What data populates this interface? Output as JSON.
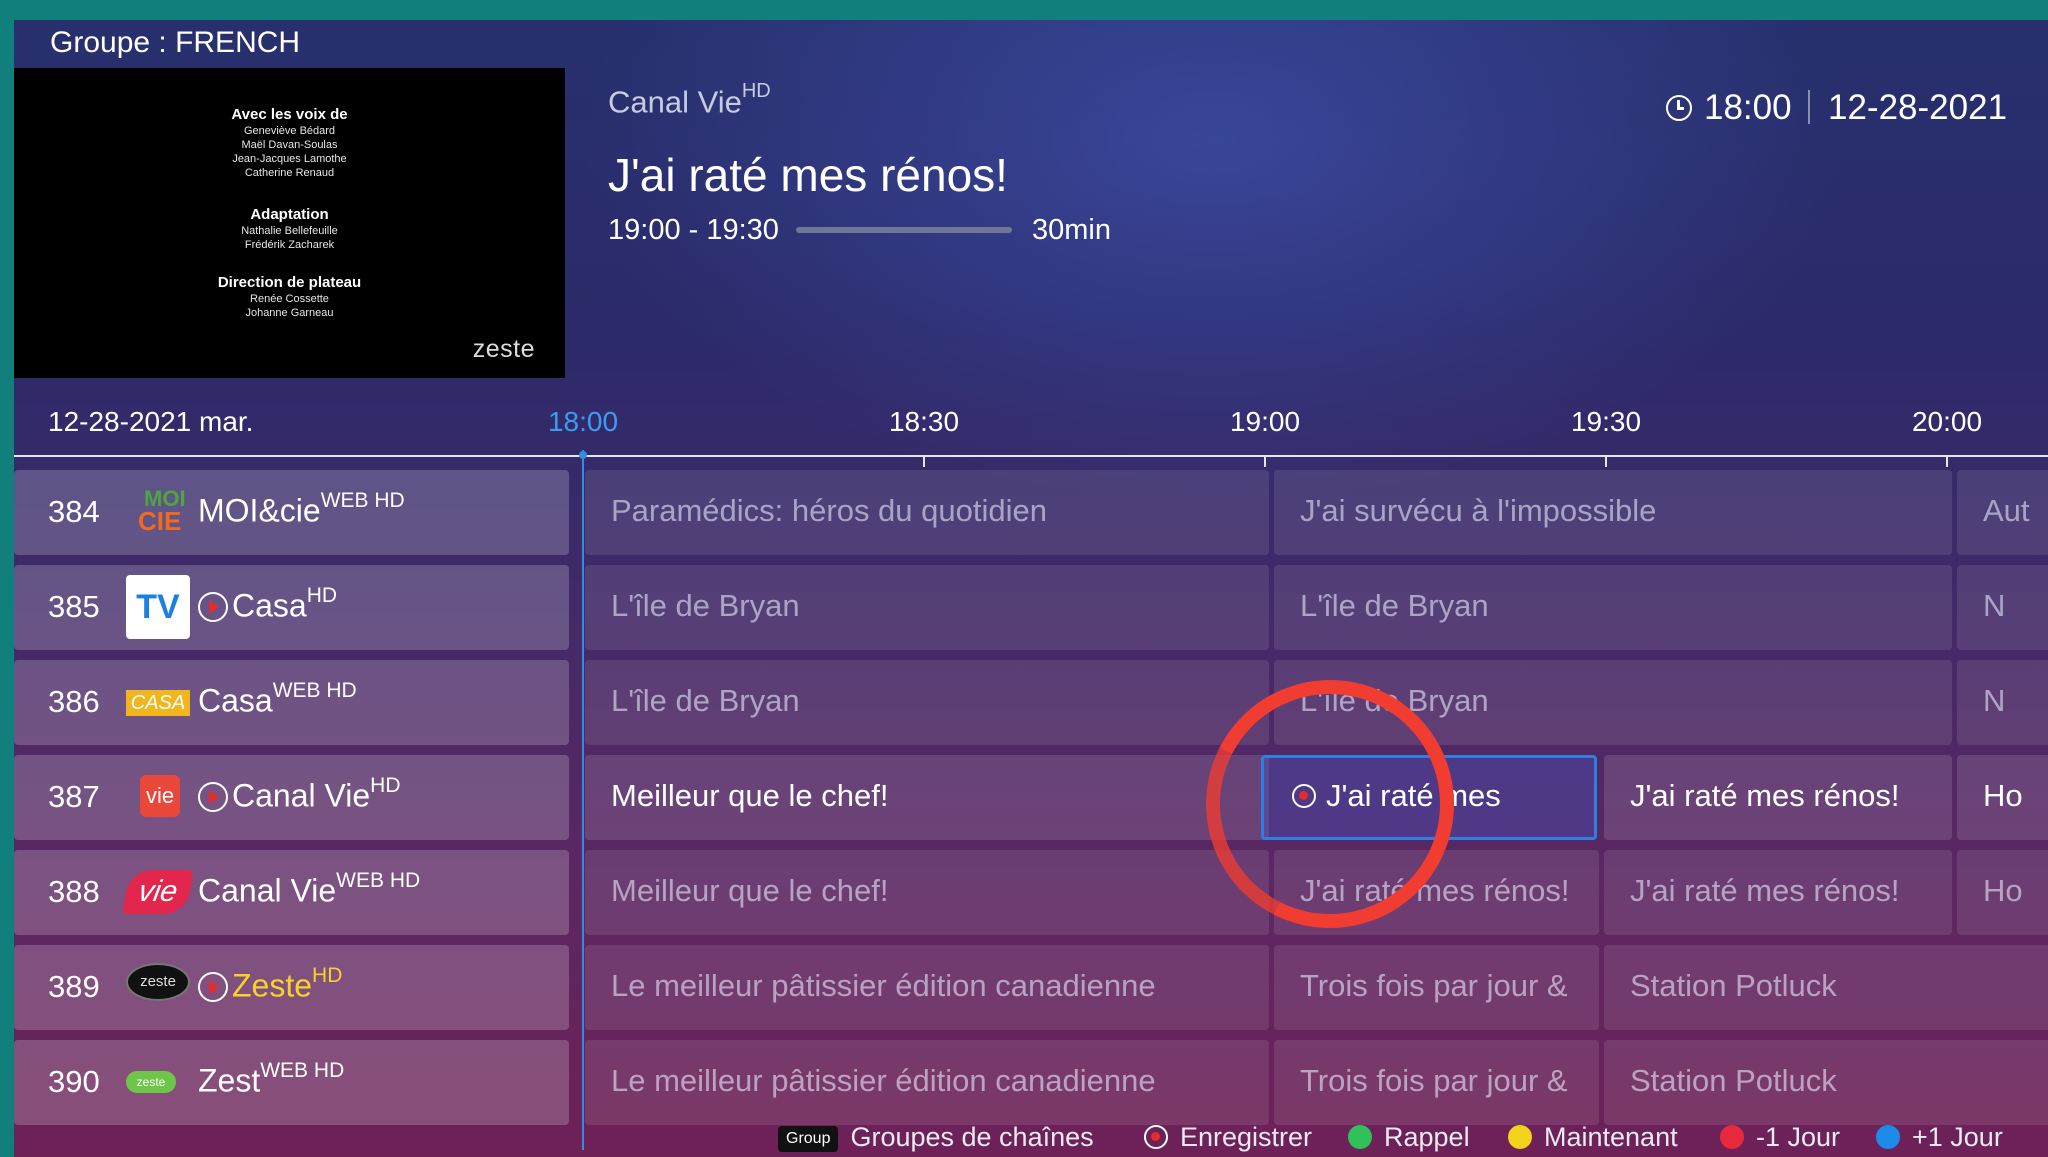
{
  "header": {
    "group_label": "Groupe : FRENCH",
    "channel_name": "Canal Vie",
    "channel_badge": "HD",
    "program_title": "J'ai raté mes rénos!",
    "time_range": "19:00 - 19:30",
    "progress_fraction": 0.0,
    "duration": "30min",
    "clock_time": "18:00",
    "clock_date": "12-28-2021"
  },
  "preview": {
    "blocks": [
      {
        "title": "Avec les voix de",
        "lines": [
          "Geneviève Bédard",
          "Maël Davan-Soulas",
          "Jean-Jacques Lamothe",
          "Catherine Renaud"
        ]
      },
      {
        "title": "Adaptation",
        "lines": [
          "Nathalie Bellefeuille",
          "Frédérik Zacharek"
        ]
      },
      {
        "title": "Direction de plateau",
        "lines": [
          "Renée Cossette",
          "Johanne Garneau"
        ]
      }
    ],
    "logo_text": "zeste"
  },
  "timeline": {
    "date_label": "12-28-2021 mar.",
    "times": [
      "18:00",
      "18:30",
      "19:00",
      "19:30",
      "20:00"
    ],
    "current": "18:00"
  },
  "channels": [
    {
      "number": "384",
      "name": "MOI&cie",
      "badge": "WEB HD",
      "logo": "moi-cie-logo",
      "logo_text_top": "MOI",
      "logo_text_bottom": "CIE",
      "catchup": false,
      "programs": [
        "Paramédics: héros du quotidien",
        "J'ai survécu à l'impossible",
        "Aut"
      ]
    },
    {
      "number": "385",
      "name": "Casa",
      "badge": "HD",
      "logo": "tv-logo",
      "logo_text": "TV",
      "catchup": true,
      "programs": [
        "L'île de Bryan",
        "L'île de Bryan",
        "N"
      ]
    },
    {
      "number": "386",
      "name": "Casa",
      "badge": "WEB HD",
      "logo": "casa-logo",
      "logo_text": "CASA",
      "catchup": false,
      "programs": [
        "L'île de Bryan",
        "L'île de Bryan",
        "N"
      ]
    },
    {
      "number": "387",
      "name": "Canal Vie",
      "badge": "HD",
      "logo": "canal-vie-logo",
      "logo_text": "vie",
      "catchup": true,
      "programs": [
        "Meilleur que le chef!",
        "J'ai raté mes",
        "J'ai raté mes rénos!",
        "Ho"
      ]
    },
    {
      "number": "388",
      "name": "Canal Vie",
      "badge": "WEB HD",
      "logo": "vie-logo",
      "logo_text": "vie",
      "catchup": false,
      "programs": [
        "Meilleur que le chef!",
        "J'ai raté mes rénos!",
        "J'ai raté mes rénos!",
        "Ho"
      ]
    },
    {
      "number": "389",
      "name": "Zeste",
      "badge": "HD",
      "logo": "zeste-logo",
      "logo_text": "zeste",
      "catchup": true,
      "programs": [
        "Le meilleur pâtissier édition canadienne",
        "Trois fois par jour &",
        "Station Potluck"
      ]
    },
    {
      "number": "390",
      "name": "Zest",
      "badge": "WEB HD",
      "logo": "zest-logo",
      "logo_text": "zeste",
      "catchup": false,
      "programs": [
        "Le meilleur pâtissier édition canadienne",
        "Trois fois par jour &",
        "Station Potluck"
      ]
    }
  ],
  "legend": {
    "group_chip": "Group",
    "group_label": "Groupes de chaînes",
    "record_label": "Enregistrer",
    "green_label": "Rappel",
    "yellow_label": "Maintenant",
    "red_label": "-1 Jour",
    "blue_label": "+1 Jour",
    "colors": {
      "green": "#2fc25b",
      "yellow": "#f2d21b",
      "red": "#e8283c",
      "blue": "#1f8be8"
    }
  },
  "colors": {
    "accent": "#2f8de4",
    "teal_frame": "#11807c",
    "annotation_circle": "#f03c31"
  }
}
